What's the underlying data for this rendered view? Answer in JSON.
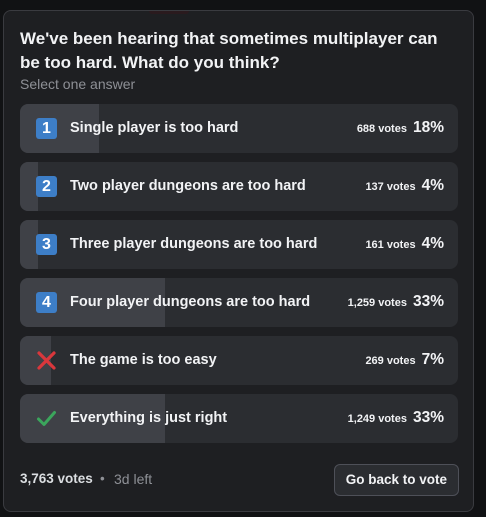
{
  "poll": {
    "question": "We've been hearing that sometimes multiplayer can be too hard. What do you think?",
    "hint": "Select one answer",
    "answers": [
      {
        "icon": "number-1-icon",
        "icon_text": "1",
        "label": "Single player is too hard",
        "votes": "688 votes",
        "percent": "18%",
        "fraction": 0.18
      },
      {
        "icon": "number-2-icon",
        "icon_text": "2",
        "label": "Two player dungeons are too hard",
        "votes": "137 votes",
        "percent": "4%",
        "fraction": 0.04
      },
      {
        "icon": "number-3-icon",
        "icon_text": "3",
        "label": "Three player dungeons are too hard",
        "votes": "161 votes",
        "percent": "4%",
        "fraction": 0.04
      },
      {
        "icon": "number-4-icon",
        "icon_text": "4",
        "label": "Four player dungeons are too hard",
        "votes": "1,259 votes",
        "percent": "33%",
        "fraction": 0.33
      },
      {
        "icon": "cross-mark-icon",
        "icon_text": "",
        "label": "The game is too easy",
        "votes": "269 votes",
        "percent": "7%",
        "fraction": 0.07
      },
      {
        "icon": "check-mark-icon",
        "icon_text": "",
        "label": "Everything is just right",
        "votes": "1,249 votes",
        "percent": "33%",
        "fraction": 0.33
      }
    ],
    "total_votes": "3,763 votes",
    "separator": "•",
    "time_left": "3d left",
    "back_button_label": "Go back to vote"
  },
  "colors": {
    "background": "#1e1f22",
    "answer_bg": "#2b2d31",
    "answer_fill": "#3f4147",
    "number_icon": "#3d7ec7",
    "cross": "#da373c",
    "check": "#3ba55c"
  }
}
